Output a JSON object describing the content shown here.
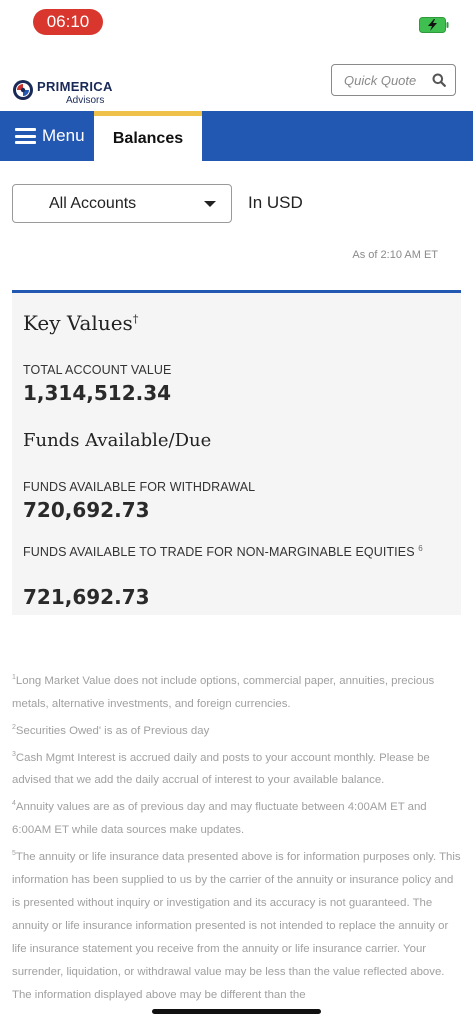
{
  "status_bar": {
    "time": "06:10"
  },
  "header": {
    "brand_name": "PRIMERICA",
    "brand_sub": "Advisors",
    "quick_quote_placeholder": "Quick Quote"
  },
  "nav": {
    "menu_label": "Menu",
    "active_tab": "Balances"
  },
  "account": {
    "selected": "All Accounts",
    "currency": "In USD",
    "as_of": "As of  2:10 AM ET"
  },
  "key_values": {
    "title": "Key Values",
    "title_mark": "†",
    "total_label": "TOTAL ACCOUNT VALUE",
    "total_value": "1,314,512.34",
    "funds_title": "Funds Available/Due",
    "withdrawal_label": "FUNDS AVAILABLE FOR WITHDRAWAL",
    "withdrawal_value": "720,692.73",
    "trade_label": "FUNDS AVAILABLE TO TRADE FOR NON-MARGINABLE EQUITIES",
    "trade_footnote": "6",
    "trade_value": "721,692.73"
  },
  "footnotes": [
    {
      "num": "1",
      "text": "Long Market Value does not include options, commercial paper, annuities, precious metals, alternative investments, and foreign currencies."
    },
    {
      "num": "2",
      "text": "Securities Owed' is as of Previous day"
    },
    {
      "num": "3",
      "text": "Cash Mgmt Interest is accrued daily and posts to your account monthly. Please be advised that we add the daily accrual of interest to your available balance."
    },
    {
      "num": "4",
      "text": "Annuity values are as of previous day and may fluctuate between 4:00AM ET and 6:00AM ET while data sources make updates."
    },
    {
      "num": "5",
      "text": "The annuity or life insurance data presented above is for information purposes only. This information has been supplied to us by the carrier of the annuity or insurance policy and is presented without inquiry or investigation and its accuracy is not guaranteed. The annuity or life insurance information presented is not intended to replace the annuity or life insurance statement you receive from the annuity or life insurance carrier. Your surrender, liquidation, or withdrawal value may be less than the value reflected above. The information displayed above may be different than the"
    }
  ],
  "colors": {
    "nav_blue": "#2358b2",
    "tab_accent": "#eec14a",
    "time_pill": "#d9372e"
  }
}
